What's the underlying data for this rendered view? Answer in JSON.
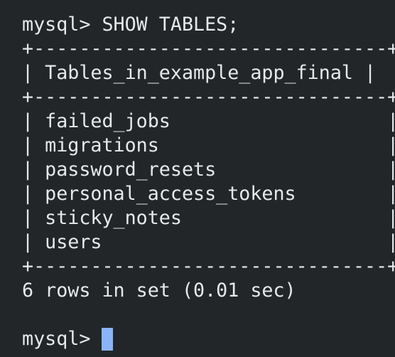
{
  "terminal": {
    "command_line": "mysql> SHOW TABLES;",
    "border_top": "+-------------------------------+",
    "header_row": "| Tables_in_example_app_final |",
    "border_mid": "+-------------------------------+",
    "rows": [
      "| failed_jobs                   |",
      "| migrations                    |",
      "| password_resets               |",
      "| personal_access_tokens        |",
      "| sticky_notes                  |",
      "| users                         |"
    ],
    "border_bottom": "+-------------------------------+",
    "result_summary": "6 rows in set (0.01 sec)",
    "blank_line": "",
    "prompt": "mysql> "
  },
  "colors": {
    "background": "#232629",
    "text": "#e6e8ea",
    "cursor": "#8ab4f8"
  }
}
